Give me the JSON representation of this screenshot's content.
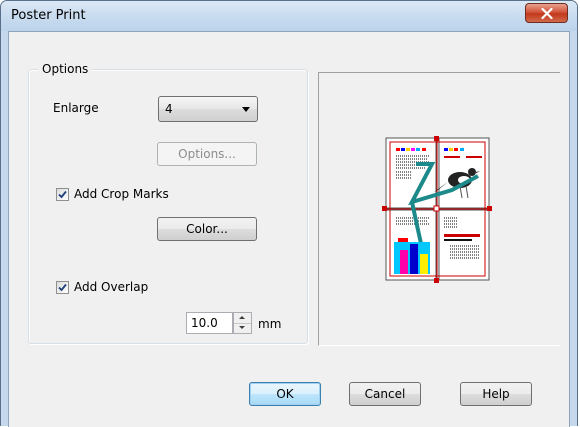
{
  "window": {
    "title": "Poster Print",
    "close_icon": "close-icon"
  },
  "options_group": {
    "legend": "Options",
    "enlarge_label": "Enlarge",
    "enlarge_value": "4",
    "options_button": "Options...",
    "add_crop_marks": {
      "label": "Add Crop Marks",
      "checked": true
    },
    "color_button": "Color...",
    "add_overlap": {
      "label": "Add Overlap",
      "checked": true
    },
    "overlap_value": "10.0",
    "overlap_unit": "mm"
  },
  "footer": {
    "ok": "OK",
    "cancel": "Cancel",
    "help": "Help"
  },
  "colors": {
    "titlebar": "#c9dcef",
    "close": "#c2381b",
    "dialog_bg": "#f0f0f0",
    "crop_mark_red": "#cc0000"
  }
}
